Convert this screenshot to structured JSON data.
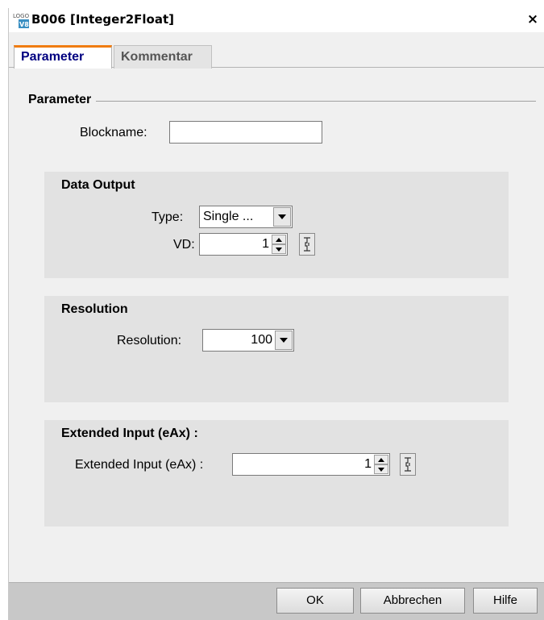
{
  "window": {
    "title": "B006 [Integer2Float]",
    "close_glyph": "×",
    "icon": "logo-icon",
    "icon_text_top": "LOGO",
    "icon_text_bottom": "V8"
  },
  "tabs": [
    {
      "label": "Parameter",
      "active": true
    },
    {
      "label": "Kommentar",
      "active": false
    }
  ],
  "parameter_group": {
    "title": "Parameter",
    "blockname_label": "Blockname:",
    "blockname_value": ""
  },
  "data_output": {
    "title": "Data Output",
    "type_label": "Type:",
    "type_value": "Single ...",
    "vd_label": "VD:",
    "vd_value": "1"
  },
  "resolution": {
    "title": "Resolution",
    "label": "Resolution:",
    "value": "100"
  },
  "extended_input": {
    "title": "Extended Input (eAx) :",
    "label": "Extended Input (eAx) :",
    "value": "1"
  },
  "buttons": {
    "ok": "OK",
    "cancel": "Abbrechen",
    "help": "Hilfe"
  },
  "colors": {
    "active_tab_text": "#000080",
    "active_tab_accent": "#f07c10",
    "panel_bg": "#e2e2e2",
    "footer_bg": "#c8c8c8"
  }
}
